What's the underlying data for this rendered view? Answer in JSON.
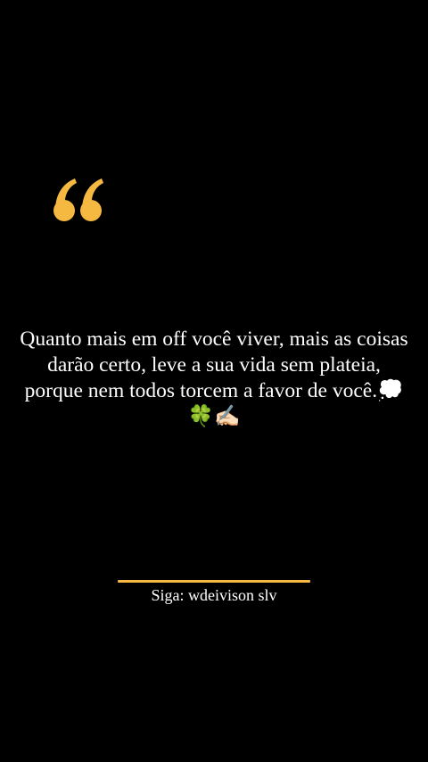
{
  "post": {
    "quote_icon": "open-double-quote-icon",
    "quote_text": "Quanto mais em off você viver, mais as coisas darão certo, leve a sua vida sem plateia, porque nem todos torcem a favor de você.💭🍀✍🏻",
    "follow_label": "Siga: wdeivison slv"
  },
  "colors": {
    "background": "#000000",
    "text": "#ffffff",
    "accent": "#f5b942"
  }
}
